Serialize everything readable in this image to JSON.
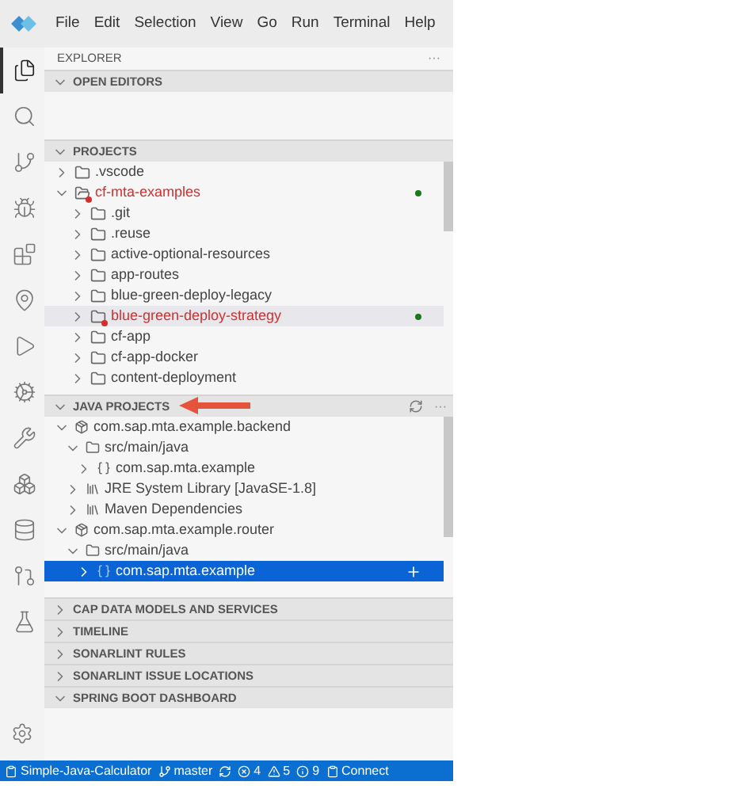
{
  "menu": [
    "File",
    "Edit",
    "Selection",
    "View",
    "Go",
    "Run",
    "Terminal",
    "Help"
  ],
  "activity_bar": [
    {
      "kind": "explorer",
      "selected": true
    },
    {
      "kind": "search",
      "selected": false
    },
    {
      "kind": "source-control",
      "selected": false
    },
    {
      "kind": "debug",
      "selected": false
    },
    {
      "kind": "extensions",
      "selected": false
    },
    {
      "kind": "pin",
      "selected": false
    },
    {
      "kind": "run",
      "selected": false
    },
    {
      "kind": "cog",
      "selected": false
    },
    {
      "kind": "tools",
      "selected": false
    },
    {
      "kind": "boxes",
      "selected": false
    },
    {
      "kind": "database",
      "selected": false
    },
    {
      "kind": "git-circle",
      "selected": false
    },
    {
      "kind": "flask",
      "selected": false
    }
  ],
  "sidebar": {
    "title": "EXPLORER",
    "more": "···"
  },
  "open_editors": {
    "title": "OPEN EDITORS",
    "expanded": true
  },
  "projects": {
    "title": "PROJECTS",
    "expanded": true,
    "items": [
      {
        "label": ".vscode",
        "expanded": false,
        "modified": false,
        "selected": false
      },
      {
        "label": "cf-mta-examples",
        "expanded": true,
        "modified": true,
        "selected": false,
        "children": [
          {
            "label": ".git",
            "expanded": false,
            "modified": false,
            "selected": false
          },
          {
            "label": ".reuse",
            "expanded": false,
            "modified": false,
            "selected": false
          },
          {
            "label": "active-optional-resources",
            "expanded": false,
            "modified": false,
            "selected": false
          },
          {
            "label": "app-routes",
            "expanded": false,
            "modified": false,
            "selected": false
          },
          {
            "label": "blue-green-deploy-legacy",
            "expanded": false,
            "modified": false,
            "selected": false
          },
          {
            "label": "blue-green-deploy-strategy",
            "expanded": false,
            "modified": true,
            "selected": true
          },
          {
            "label": "cf-app",
            "expanded": false,
            "modified": false,
            "selected": false
          },
          {
            "label": "cf-app-docker",
            "expanded": false,
            "modified": false,
            "selected": false
          },
          {
            "label": "content-deployment",
            "expanded": false,
            "modified": false,
            "selected": false
          }
        ]
      }
    ]
  },
  "java_projects": {
    "title": "JAVA PROJECTS",
    "expanded": true,
    "more": "···",
    "items": [
      {
        "kind": "project",
        "label": "com.sap.mta.example.backend",
        "expanded": true,
        "selected": false,
        "children": [
          {
            "kind": "source",
            "label": "src/main/java",
            "expanded": true,
            "selected": false,
            "children": [
              {
                "kind": "package",
                "label": "com.sap.mta.example",
                "expanded": false,
                "selected": false
              }
            ]
          },
          {
            "kind": "library",
            "label": "JRE System Library [JavaSE-1.8]",
            "expanded": false,
            "selected": false
          },
          {
            "kind": "library",
            "label": "Maven Dependencies",
            "expanded": false,
            "selected": false
          }
        ]
      },
      {
        "kind": "project",
        "label": "com.sap.mta.example.router",
        "expanded": true,
        "selected": false,
        "children": [
          {
            "kind": "source",
            "label": "src/main/java",
            "expanded": true,
            "selected": false,
            "children": [
              {
                "kind": "package",
                "label": "com.sap.mta.example",
                "expanded": false,
                "selected": true
              }
            ]
          }
        ]
      }
    ]
  },
  "collapsed_sections": [
    {
      "title": "CAP DATA MODELS AND SERVICES",
      "expanded": false
    },
    {
      "title": "TIMELINE",
      "expanded": false
    },
    {
      "title": "SONARLINT RULES",
      "expanded": false
    },
    {
      "title": "SONARLINT ISSUE LOCATIONS",
      "expanded": false
    },
    {
      "title": "SPRING BOOT DASHBOARD",
      "expanded": true
    }
  ],
  "status_bar": [
    {
      "kind": "project",
      "label": "Simple-Java-Calculator"
    },
    {
      "kind": "branch",
      "label": "master"
    },
    {
      "kind": "sync"
    },
    {
      "kind": "errors",
      "label": "4"
    },
    {
      "kind": "warnings",
      "label": "5"
    },
    {
      "kind": "info",
      "label": "9"
    },
    {
      "kind": "connect",
      "label": "Connect"
    }
  ]
}
